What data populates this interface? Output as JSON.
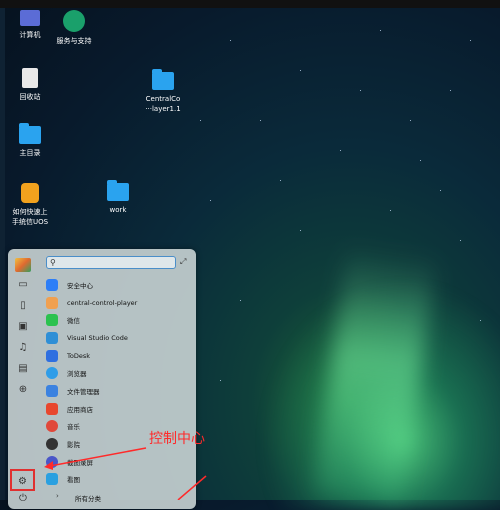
{
  "desktop": {
    "icons": [
      {
        "label": "计算机",
        "icon": "computer-icon",
        "color": "#5b6cd6"
      },
      {
        "label": "服务与支持",
        "icon": "support-icon",
        "color": "#1aa06b"
      },
      {
        "label": "回收站",
        "icon": "trash-icon",
        "color": "#e8e8e8"
      },
      {
        "label": "CentralCo\n···layer1.1",
        "icon": "folder-icon",
        "color": "#2aa3ef"
      },
      {
        "label": "主目录",
        "icon": "home-folder-icon",
        "color": "#2aa3ef"
      },
      {
        "label": "如何快速上\n手统信UOS",
        "icon": "lightbulb-icon",
        "color": "#f2a21e"
      },
      {
        "label": "work",
        "icon": "folder-icon",
        "color": "#2aa3ef"
      }
    ]
  },
  "start_menu": {
    "search_placeholder": "",
    "apps": [
      {
        "label": "安全中心",
        "icon": "security-center-icon",
        "color": "#2d7ef7"
      },
      {
        "label": "central-control-player",
        "icon": "player-icon",
        "color": "#f0a050"
      },
      {
        "label": "微信",
        "icon": "wechat-icon",
        "color": "#2bc24f"
      },
      {
        "label": "Visual Studio Code",
        "icon": "vscode-icon",
        "color": "#2f8fd6"
      },
      {
        "label": "ToDesk",
        "icon": "todesk-icon",
        "color": "#2f6fe0"
      },
      {
        "label": "浏览器",
        "icon": "browser-icon",
        "color": "#2f9de8"
      },
      {
        "label": "文件管理器",
        "icon": "file-manager-icon",
        "color": "#3b82e0"
      },
      {
        "label": "应用商店",
        "icon": "app-store-icon",
        "color": "#e8472e"
      },
      {
        "label": "音乐",
        "icon": "music-icon",
        "color": "#e0483a"
      },
      {
        "label": "影院",
        "icon": "movie-icon",
        "color": "#333333"
      },
      {
        "label": "截图录屏",
        "icon": "screenshot-icon",
        "color": "#4a56c8"
      },
      {
        "label": "看图",
        "icon": "image-viewer-icon",
        "color": "#2aa0e0"
      }
    ],
    "all_categories": "所有分类"
  },
  "annotation": {
    "text": "控制中心",
    "color": "#ff2a2a"
  }
}
